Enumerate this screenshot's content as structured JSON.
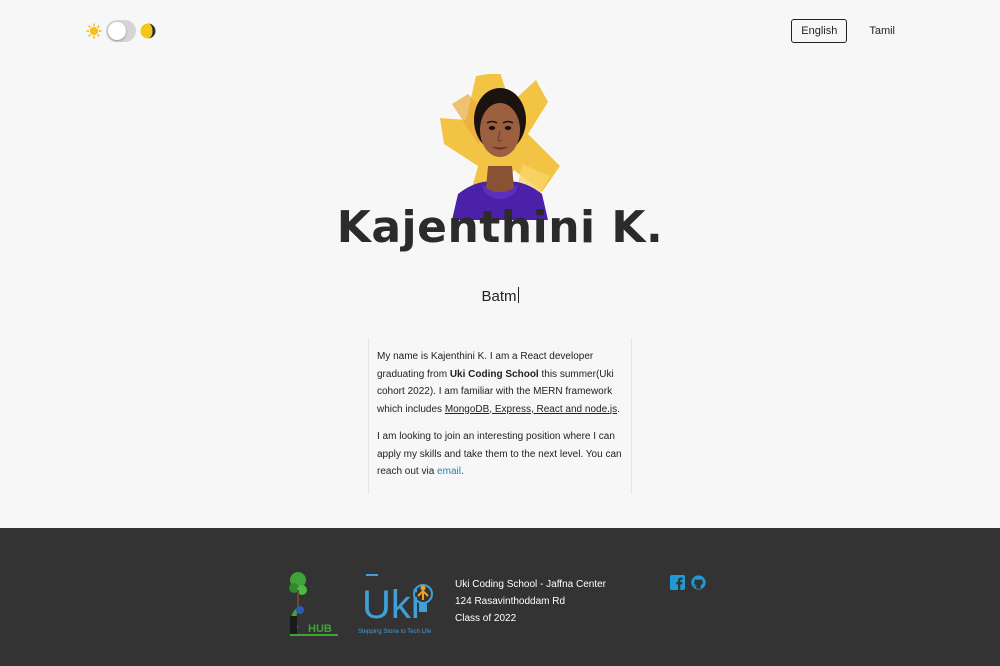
{
  "header": {
    "theme_toggle": {
      "light_icon": "sun-icon",
      "dark_icon": "moon-icon",
      "state": "light"
    },
    "languages": [
      "English",
      "Tamil"
    ],
    "active_language": "English"
  },
  "hero": {
    "name": "Kajenthini K.",
    "typed_text": "Batm"
  },
  "about": {
    "p1_a": "My name is Kajenthini K. I am a React developer graduating from ",
    "p1_school": "Uki Coding School",
    "p1_b": " this summer(Uki cohort 2022). I am familiar with the MERN framework which includes ",
    "p1_stack": "MongoDB, Express, React and node.js",
    "p1_end": ".",
    "p2_a": "I am looking to join an interesting position where I can apply my skills and take them to the next level. You can reach out via ",
    "p2_link": "email",
    "p2_end": "."
  },
  "footer": {
    "ihub_text": "HUB",
    "uki_text": "Uki",
    "uki_tagline": "Stepping Stone to Tech Life",
    "school_line1": "Uki Coding School - Jaffna Center",
    "school_line2": "124 Rasavinthoddam Rd",
    "school_line3": "Class of 2022",
    "social_icons": [
      "facebook-icon",
      "github-icon"
    ]
  },
  "colors": {
    "background": "#f7f7f7",
    "footer": "#333333",
    "link": "#1e88b4",
    "social": "#1e9ad6",
    "brush_yellow": "#f3c344"
  }
}
